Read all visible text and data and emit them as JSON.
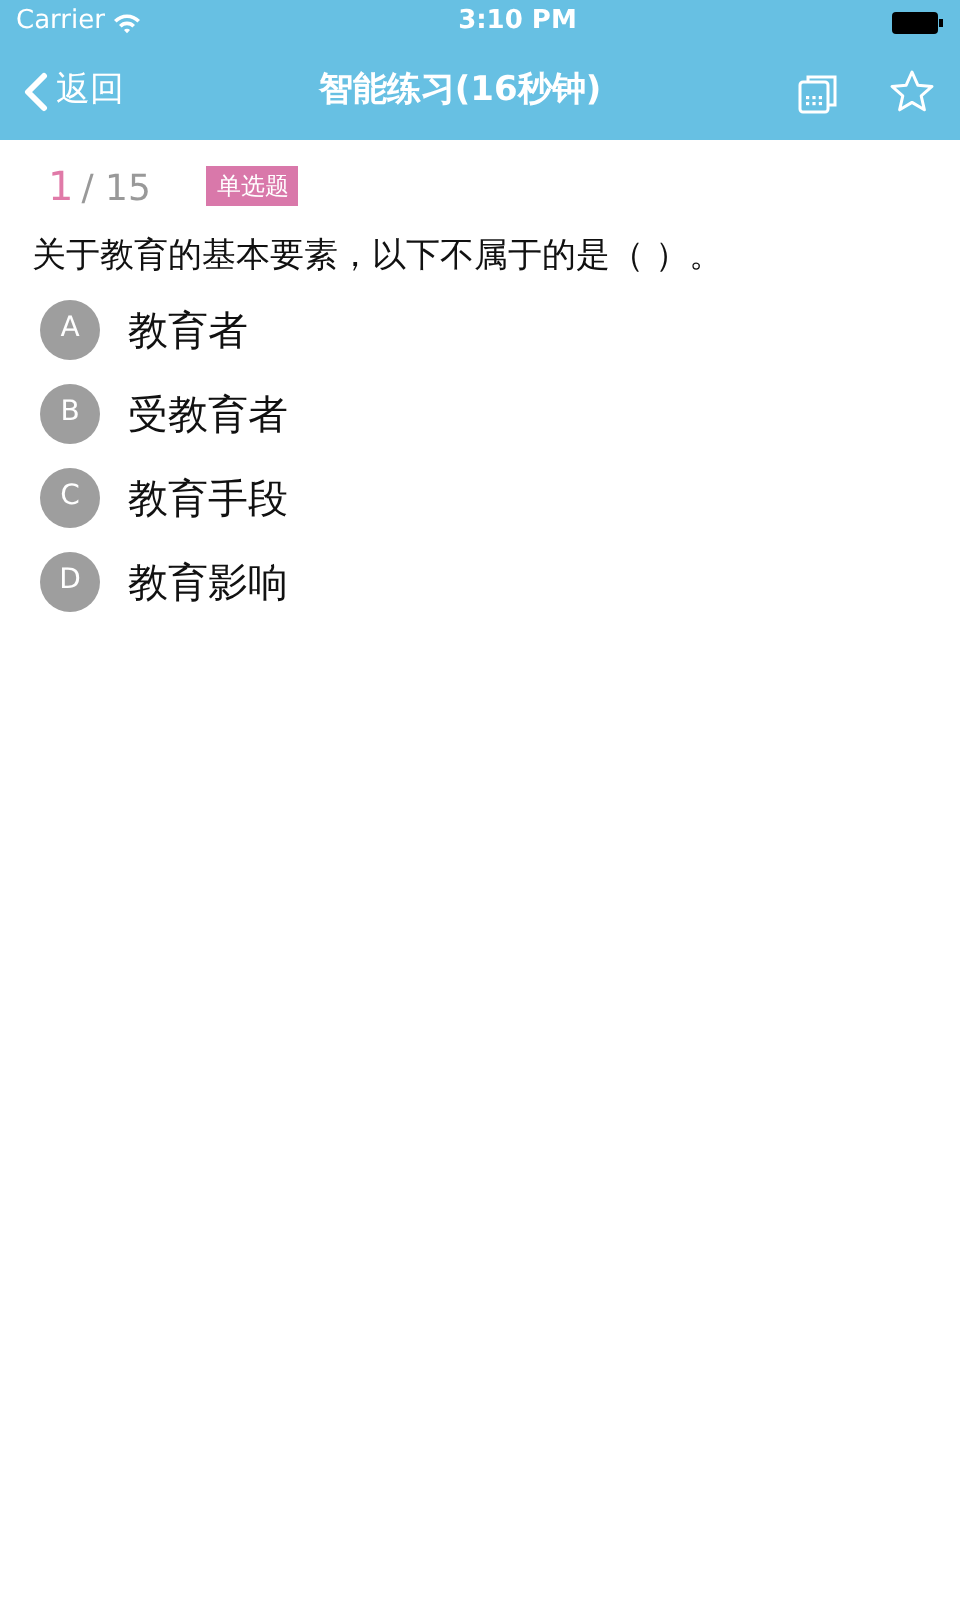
{
  "status_bar": {
    "carrier": "Carrier",
    "time": "3:10 PM"
  },
  "nav": {
    "back": "返回",
    "title": "智能练习(16秒钟)"
  },
  "progress": {
    "current": "1",
    "total": "/ 15",
    "type_tag": "单选题"
  },
  "question": "关于教育的基本要素，以下不属于的是（ ）。",
  "options": [
    {
      "letter": "A",
      "text": "教育者",
      "selected": false
    },
    {
      "letter": "B",
      "text": "受教育者",
      "selected": false
    },
    {
      "letter": "C",
      "text": "教育手段",
      "selected": false
    },
    {
      "letter": "D",
      "text": "教育影响",
      "selected": false
    }
  ]
}
